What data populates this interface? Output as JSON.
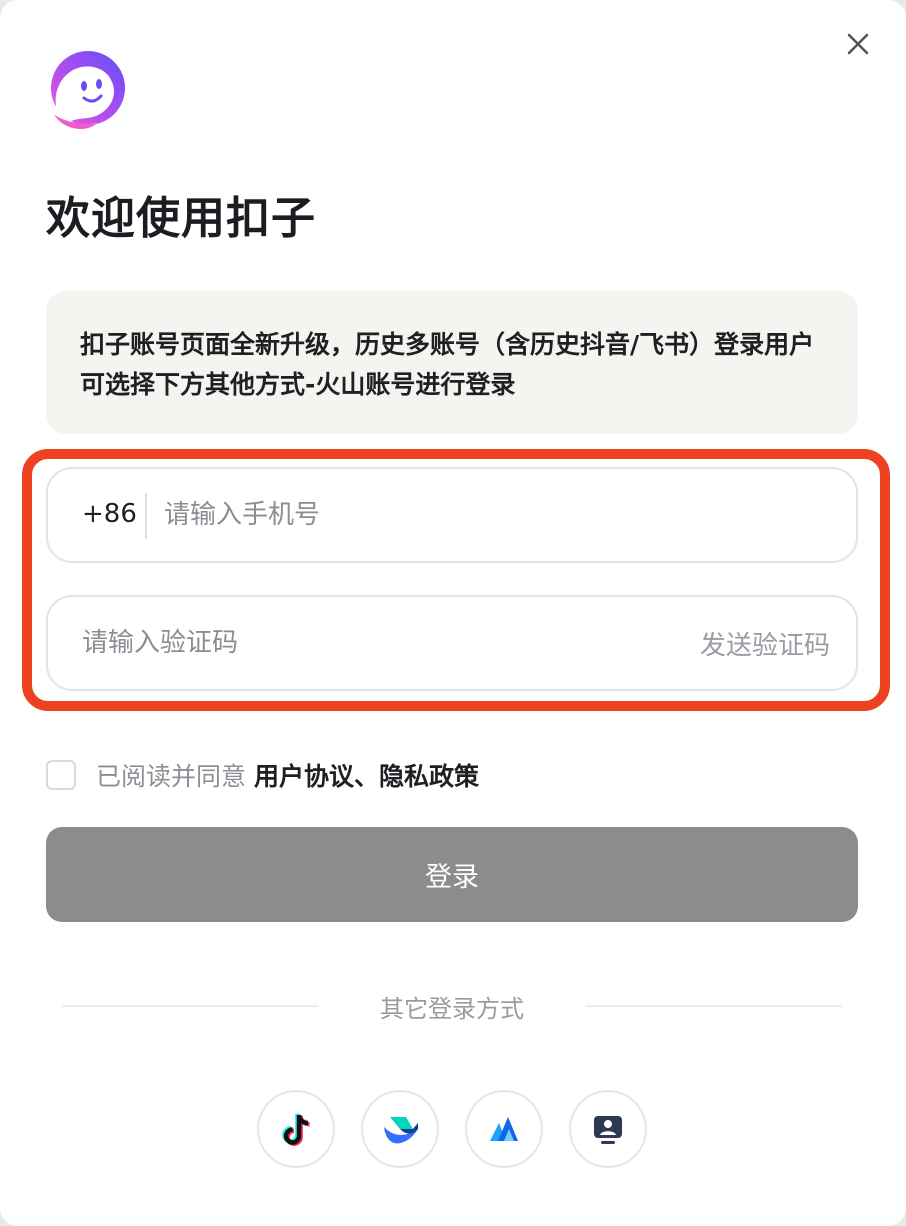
{
  "dialog": {
    "title": "欢迎使用扣子",
    "notice": "扣子账号页面全新升级，历史多账号（含历史抖音/飞书）登录用户可选择下方其他方式-火山账号进行登录"
  },
  "phone_field": {
    "country_code": "+86",
    "placeholder": "请输入手机号",
    "value": ""
  },
  "code_field": {
    "placeholder": "请输入验证码",
    "value": "",
    "send_code_label": "发送验证码"
  },
  "agreement": {
    "checked": false,
    "prefix": "已阅读并同意",
    "links": "用户协议、隐私政策"
  },
  "login_button": {
    "label": "登录"
  },
  "other_login": {
    "label": "其它登录方式",
    "methods": [
      {
        "icon": "douyin-icon"
      },
      {
        "icon": "feishu-icon"
      },
      {
        "icon": "volcengine-icon"
      },
      {
        "icon": "account-icon"
      }
    ]
  },
  "colors": {
    "highlight_border": "#ec4222",
    "login_button_bg": "#8c8c8c",
    "notice_bg": "#f5f4f1"
  }
}
